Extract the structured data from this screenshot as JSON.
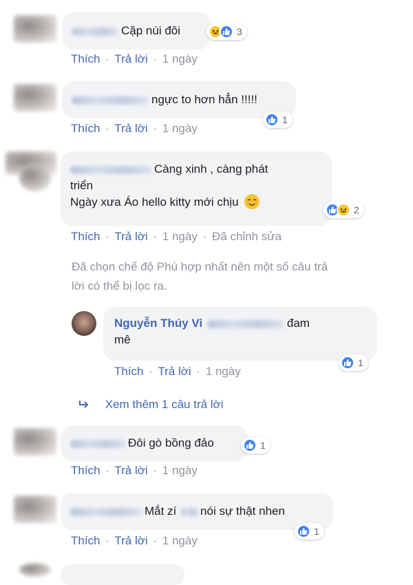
{
  "actions": {
    "like": "Thích",
    "reply": "Trả lời",
    "separator": "·",
    "edited": "Đã chỉnh sửa"
  },
  "comments": [
    {
      "text": "Cặp núi đôi",
      "time": "1 ngày",
      "reaction_count": "3",
      "reactions": [
        "haha",
        "like"
      ]
    },
    {
      "text": "ngực to hơn hẳn !!!!!",
      "time": "1 ngày",
      "reaction_count": "1",
      "reactions": [
        "like"
      ]
    },
    {
      "text_line1": "Càng xinh , càng phát",
      "text_line2": "triển",
      "text_line3": "Ngày xưa Áo hello kitty mới chịu",
      "emoji": "smiling-face",
      "time": "1 ngày",
      "reaction_count": "2",
      "reactions": [
        "like",
        "haha"
      ]
    },
    {
      "text": "Đôi gò bồng đảo",
      "time": "1 ngày",
      "reaction_count": "1",
      "reactions": [
        "like"
      ]
    },
    {
      "text": "Mắt zí",
      "text_after": "nói sự thật nhen",
      "time": "1 ngày",
      "reaction_count": "1",
      "reactions": [
        "like"
      ]
    }
  ],
  "filter_notice": {
    "line1": "Đã chọn chế độ Phù hợp nhất nên một số câu trả",
    "line2": "lời có thể bị lọc ra."
  },
  "reply": {
    "author": "Nguyễn Thúy Vi",
    "text_line1": "đam",
    "text_line2": "mê",
    "time": "1 ngày",
    "reaction_count": "1"
  },
  "view_more": {
    "icon": "reply-arrow-icon",
    "label": "Xem thêm 1 câu trả lời"
  },
  "colors": {
    "link": "#4267b2",
    "muted": "#90949c",
    "bubble": "#f2f3f5",
    "like": "#3b82f0",
    "haha": "#f7c631"
  }
}
